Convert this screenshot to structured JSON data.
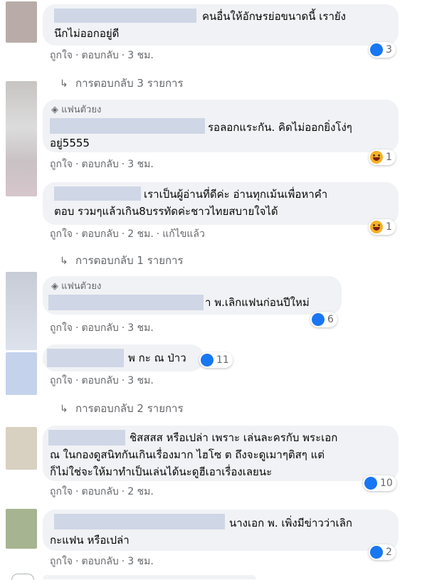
{
  "labels": {
    "like": "ถูกใจ",
    "reply": "ตอบกลับ",
    "edited": "แก้ไขแล้ว",
    "fan_badge": "แฟนตัวยง",
    "dot": "·"
  },
  "colors": {
    "link_gray": "#65676b",
    "bubble_bg": "#f0f2f5",
    "like_blue": "#1877f2",
    "haha_yellow": "#f7b125"
  },
  "comments": [
    {
      "lines": [
        "คนอื่นให้อักษรย่อขนาดนี้ เรายัง",
        "นึกไม่ออกอยู่ดี"
      ],
      "time": "3 ชม.",
      "reaction": {
        "type": "like-icon",
        "count": "3"
      },
      "reply_link": "การตอบกลับ 3 รายการ"
    },
    {
      "badge": true,
      "lines": [
        "รอลอกแระกัน. คิดไม่ออกยิ่งโง่ๆ",
        "อยู่5555"
      ],
      "time": "3 ชม.",
      "reaction": {
        "type": "haha-icon",
        "count": "1"
      }
    },
    {
      "lines": [
        "เราเป็นผู้อ่านที่ดีค่ะ อ่านทุกเม้นเพื่อหาคำ",
        "ตอบ รวมๆแล้วเกิน8บรรทัดค่ะชาวไทยสบายใจได้"
      ],
      "time": "2 ชม.",
      "edited": true,
      "reaction": {
        "type": "haha-icon",
        "count": "1"
      },
      "reply_link": "การตอบกลับ 1 รายการ"
    },
    {
      "badge": true,
      "lines": [
        "า พ.เลิกแฟนก่อนปีใหม่"
      ],
      "time": "3 ชม.",
      "reaction": {
        "type": "like-icon",
        "count": "6"
      }
    },
    {
      "lines": [
        "พ กะ ณ ป่าว"
      ],
      "time": "3 ชม.",
      "reaction": {
        "type": "like-icon",
        "count": "11"
      },
      "reply_link": "การตอบกลับ 2 รายการ"
    },
    {
      "lines": [
        "ชิสสสส หรือเปล่า เพราะ เล่นละครกับ พระเอก",
        "ณ ในกองดูสนิทกันเกินเรื่องมาก ไฮโซ ต ถึงจะดูเมาๆติสๆ แต่",
        "ก็ไม่ใช่จะให้มาทำเป็นเล่นได้นะดูฮีเอาเรื่องเลยนะ"
      ],
      "time": "2 ชม.",
      "reaction": {
        "type": "like-icon",
        "count": "10"
      }
    },
    {
      "lines": [
        "นางเอก พ. เพิ่งมีข่าวว่าเลิก",
        "กะแฟน หรือเปล่า"
      ],
      "time": "3 ชม.",
      "reaction": {
        "type": "like-icon",
        "count": "2"
      }
    }
  ]
}
